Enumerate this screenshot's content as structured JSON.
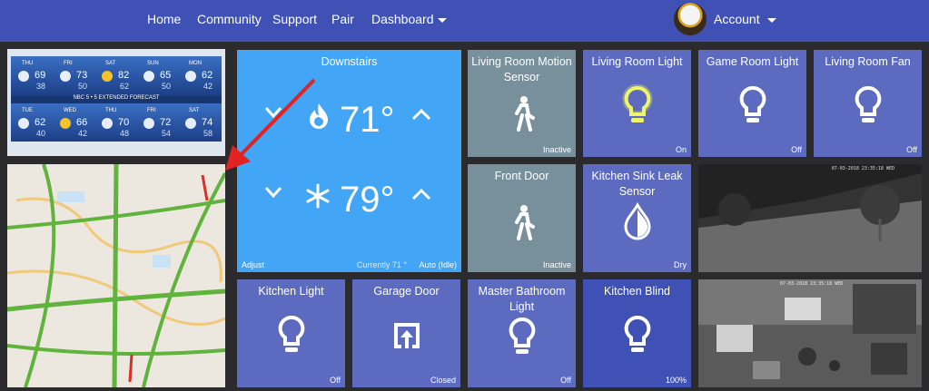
{
  "nav": {
    "home": "Home",
    "community": "Community",
    "support": "Support",
    "pair": "Pair",
    "dashboard": "Dashboard",
    "account": "Account"
  },
  "tiles": {
    "downstairs": {
      "title": "Downstairs",
      "heat_temp": "71°",
      "cool_temp": "79°",
      "adjust": "Adjust",
      "current": "Currently 71 °",
      "mode": "Auto (Idle)"
    },
    "living_room_motion": {
      "title": "Living Room Motion Sensor",
      "status": "Inactive"
    },
    "living_room_light": {
      "title": "Living Room Light",
      "status": "On"
    },
    "game_room_light": {
      "title": "Game Room Light",
      "status": "Off"
    },
    "living_room_fan": {
      "title": "Living Room Fan",
      "status": "Off"
    },
    "front_door": {
      "title": "Front Door",
      "status": "Inactive"
    },
    "kitchen_sink_leak": {
      "title": "Kitchen Sink Leak Sensor",
      "status": "Dry"
    },
    "kitchen_light": {
      "title": "Kitchen Light",
      "status": "Off"
    },
    "garage_door": {
      "title": "Garage Door",
      "status": "Closed"
    },
    "master_bath_light": {
      "title": "Master Bathroom Light",
      "status": "Off"
    },
    "kitchen_blind": {
      "title": "Kitchen Blind",
      "status": "100%"
    }
  },
  "weather": {
    "banner": "NBC 5 • 5 EXTENDED FORECAST",
    "days": [
      {
        "day": "THU",
        "hi": "69",
        "lo": "38"
      },
      {
        "day": "FRI",
        "hi": "73",
        "lo": "50"
      },
      {
        "day": "SAT",
        "hi": "82",
        "lo": "62"
      },
      {
        "day": "SUN",
        "hi": "65",
        "lo": "50"
      },
      {
        "day": "MON",
        "hi": "62",
        "lo": "42"
      },
      {
        "day": "TUE",
        "hi": "62",
        "lo": "40"
      },
      {
        "day": "WED",
        "hi": "66",
        "lo": "42"
      },
      {
        "day": "THU",
        "hi": "70",
        "lo": "48"
      },
      {
        "day": "FRI",
        "hi": "72",
        "lo": "54"
      },
      {
        "day": "SAT",
        "hi": "74",
        "lo": "58"
      }
    ]
  },
  "camera": {
    "stamp1": "07-03-2018 23:35:18 WED",
    "stamp2": "07-03-2018 23:35:18 WED"
  },
  "colors": {
    "nav": "#3f51b5",
    "tile_blue": "#5c6bc0",
    "tile_dark_blue": "#3f51b5",
    "tile_grey": "#78909c",
    "thermostat": "#42a5f5",
    "light_on_glow": "#e6ee4a",
    "arrow": "#e32222"
  }
}
